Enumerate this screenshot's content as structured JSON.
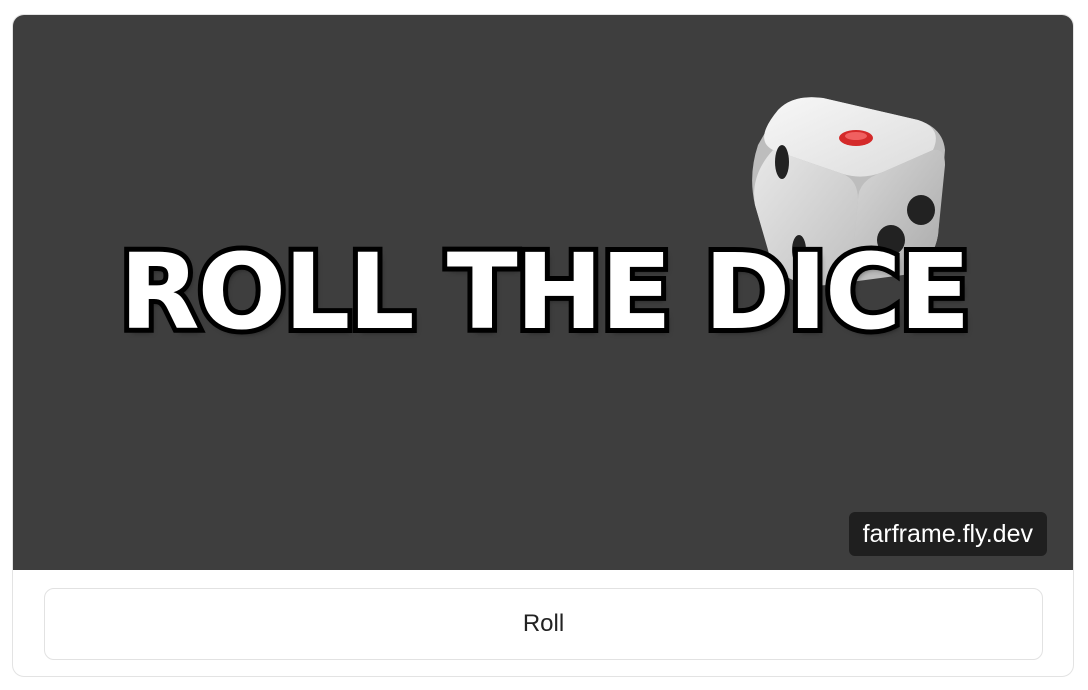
{
  "frame": {
    "headline": "ROLL THE DICE",
    "url_badge": "farframe.fly.dev",
    "image_icon": "dice-icon",
    "colors": {
      "background": "#3e3e3e",
      "headline_fill": "#ffffff",
      "headline_outline": "#000000",
      "badge_background": "#1f1f1f",
      "die_pip_red": "#d42a2a"
    }
  },
  "actions": {
    "roll_label": "Roll"
  }
}
